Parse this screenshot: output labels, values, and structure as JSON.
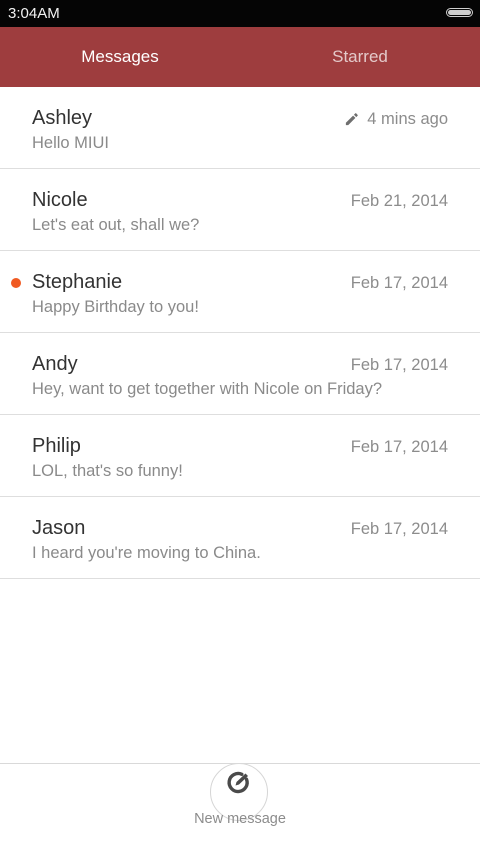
{
  "status_bar": {
    "time": "3:04AM"
  },
  "tabs": [
    {
      "label": "Messages",
      "active": true
    },
    {
      "label": "Starred",
      "active": false
    }
  ],
  "messages": [
    {
      "sender": "Ashley",
      "preview": "Hello MIUI",
      "date": "4 mins ago",
      "draft_icon": "pencil-icon",
      "unread": false
    },
    {
      "sender": "Nicole",
      "preview": "Let's eat out, shall we?",
      "date": "Feb 21, 2014",
      "unread": false
    },
    {
      "sender": "Stephanie",
      "preview": "Happy Birthday to you!",
      "date": "Feb 17, 2014",
      "unread": true
    },
    {
      "sender": "Andy",
      "preview": "Hey, want to get together with Nicole on Friday?",
      "date": "Feb 17, 2014",
      "unread": false
    },
    {
      "sender": "Philip",
      "preview": "LOL, that's so funny!",
      "date": "Feb 17, 2014",
      "unread": false
    },
    {
      "sender": "Jason",
      "preview": "I heard you're moving to China.",
      "date": "Feb 17, 2014",
      "unread": false
    }
  ],
  "bottom_bar": {
    "new_message_label": "New message",
    "new_message_icon": "compose-icon"
  },
  "colors": {
    "header": "#9e3d3e",
    "unread_dot": "#f05a22",
    "status_bar": "#050505"
  }
}
